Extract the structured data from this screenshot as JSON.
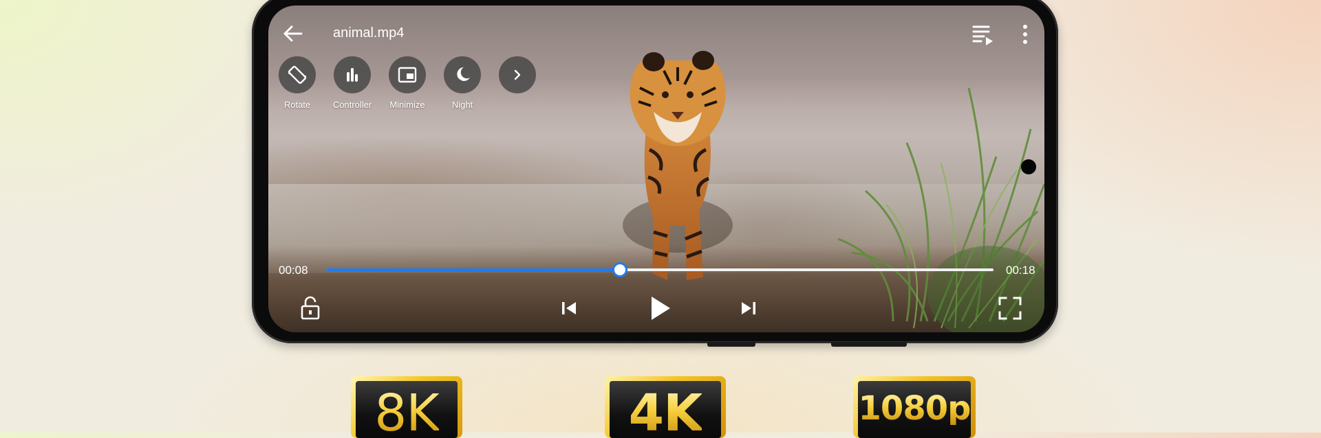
{
  "player": {
    "file_name": "animal.mp4",
    "quick_actions": [
      {
        "label": "Rotate",
        "icon": "rotate-icon"
      },
      {
        "label": "Controller",
        "icon": "equalizer-icon"
      },
      {
        "label": "Minimize",
        "icon": "picture-in-picture-icon"
      },
      {
        "label": "Night",
        "icon": "night-mode-icon"
      },
      {
        "label": "",
        "icon": "chevron-right-icon"
      }
    ],
    "current_time": "00:08",
    "total_time": "00:18",
    "progress": 0.44,
    "accent_color": "#1e7cf0",
    "top_icons": [
      "back-arrow-icon",
      "playlist-icon",
      "more-vertical-icon"
    ],
    "bottom_icons": [
      "lock-icon",
      "skip-previous-icon",
      "play-icon",
      "skip-next-icon",
      "fullscreen-icon"
    ]
  },
  "badges": {
    "b8k": "8K",
    "b4k": "4K",
    "b1080": "1080p",
    "gold_color": "#f5c928"
  }
}
